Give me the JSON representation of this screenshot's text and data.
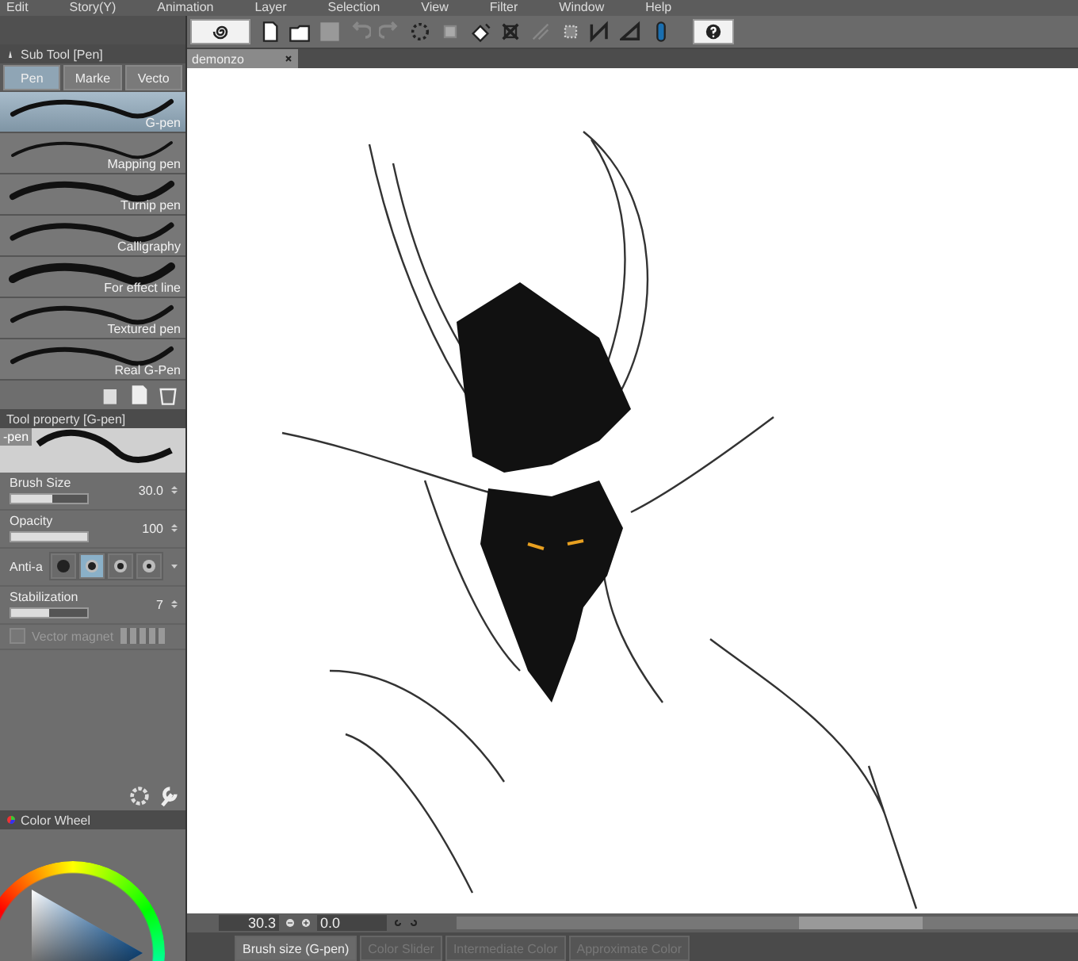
{
  "menu": [
    "Edit",
    "Story(Y)",
    "Animation",
    "Layer",
    "Selection",
    "View",
    "Filter",
    "Window",
    "Help"
  ],
  "document_tab": {
    "title": "demonzo"
  },
  "sub_tool": {
    "title": "Sub Tool [Pen]",
    "tabs": [
      {
        "label": "Pen",
        "selected": true
      },
      {
        "label": "Marke",
        "selected": false
      },
      {
        "label": "Vecto",
        "selected": false
      }
    ],
    "brushes": [
      {
        "name": "G-pen",
        "selected": true
      },
      {
        "name": "Mapping pen",
        "selected": false
      },
      {
        "name": "Turnip pen",
        "selected": false
      },
      {
        "name": "Calligraphy",
        "selected": false
      },
      {
        "name": "For effect line",
        "selected": false
      },
      {
        "name": "Textured pen",
        "selected": false
      },
      {
        "name": "Real G-Pen",
        "selected": false
      }
    ]
  },
  "tool_property": {
    "title": "Tool property [G-pen]",
    "preview_label": "-pen",
    "settings": [
      {
        "kind": "slider",
        "label": "Brush Size",
        "level": 0.55,
        "value": "30.0"
      },
      {
        "kind": "slider",
        "label": "Opacity",
        "level": 1,
        "value": "100"
      },
      {
        "kind": "choices",
        "label": "Anti-a",
        "options": [
          {
            "selected": false
          },
          {
            "selected": true
          },
          {
            "selected": false
          },
          {
            "selected": false
          }
        ]
      },
      {
        "kind": "slider",
        "label": "Stabilization",
        "level": 0.5,
        "value": "7"
      },
      {
        "kind": "checkbox",
        "label": "Vector magnet",
        "checked": false,
        "disabled": true
      }
    ]
  },
  "color_wheel": {
    "title": "Color Wheel"
  },
  "status": {
    "zoom": "30.3",
    "rotation": "0.0"
  },
  "bottom_tabs": [
    {
      "label": "Brush size (G-pen)",
      "selected": true
    },
    {
      "label": "Color Slider",
      "selected": false
    },
    {
      "label": "Intermediate Color",
      "selected": false
    },
    {
      "label": "Approximate Color",
      "selected": false
    }
  ]
}
